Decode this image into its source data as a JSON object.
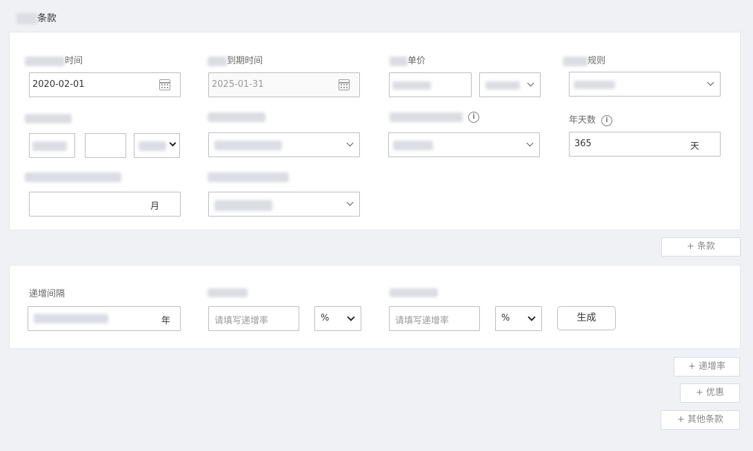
{
  "section_title": "条款",
  "terms_card": {
    "start_time": {
      "label_suffix": "时间",
      "value": "2020-02-01"
    },
    "expiry_time": {
      "label_suffix": "到期时间",
      "value": "2025-01-31"
    },
    "unit_price": {
      "label_suffix": "单价"
    },
    "rule": {
      "label_suffix": "规则"
    },
    "days_per_year": {
      "label": "年天数",
      "value": "365",
      "unit": "天"
    },
    "month_unit": "月",
    "icons": {
      "calendar": "calendar-icon",
      "info": "info-icon",
      "dropdown": "chevron-down-icon"
    }
  },
  "add_terms_button": "+ 条款",
  "increment_card": {
    "interval_label": "递增间隔",
    "interval_unit": "年",
    "rate1_placeholder": "请填写递增率",
    "rate1_unit": "%",
    "rate2_placeholder": "请填写递增率",
    "rate2_unit": "%",
    "generate_button": "生成"
  },
  "bottom_buttons": {
    "add_increment_rate": "+ 递增率",
    "add_discount": "+ 优惠",
    "add_other_terms": "+ 其他条款"
  }
}
